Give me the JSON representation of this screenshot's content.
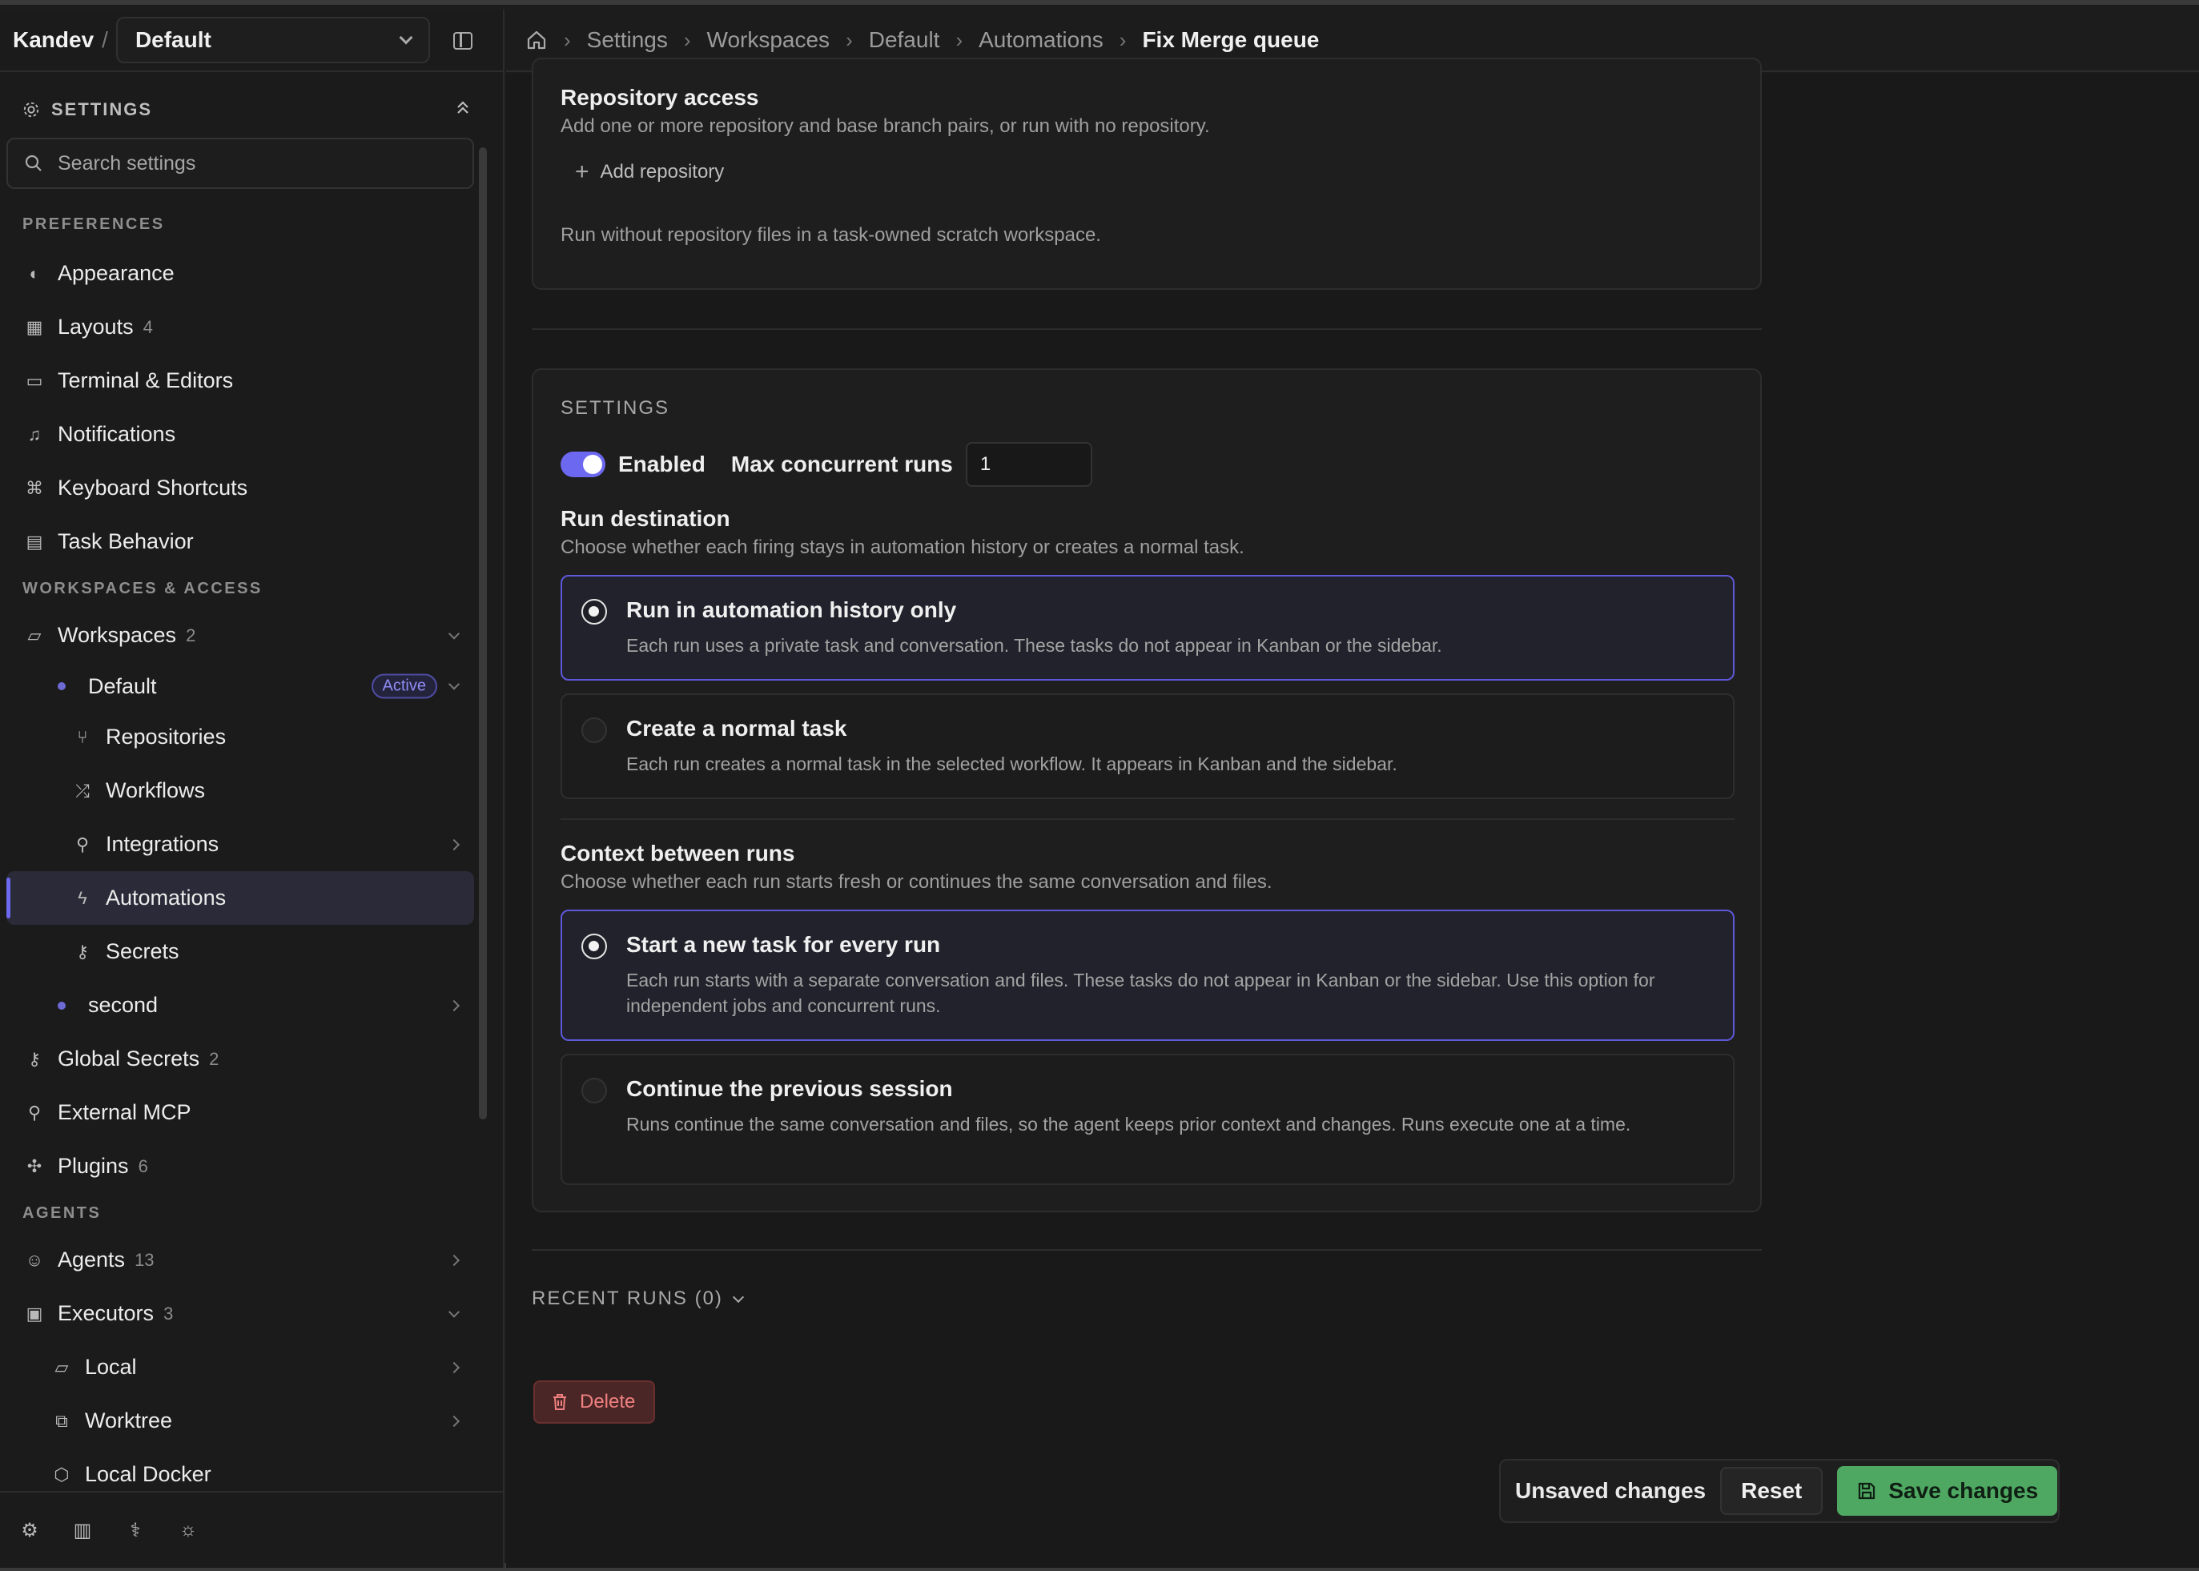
{
  "app": {
    "brand": "Kandev",
    "separator": "/",
    "workspace_select": "Default"
  },
  "sidebar": {
    "settings_label": "SETTINGS",
    "search_placeholder": "Search settings",
    "sections": {
      "preferences": "PREFERENCES",
      "workspaces_access": "WORKSPACES & ACCESS",
      "agents": "AGENTS"
    },
    "items": {
      "appearance": "Appearance",
      "layouts": "Layouts",
      "layouts_count": "4",
      "terminal": "Terminal & Editors",
      "notifications": "Notifications",
      "shortcuts": "Keyboard Shortcuts",
      "task_behavior": "Task Behavior",
      "workspaces": "Workspaces",
      "workspaces_count": "2",
      "default": "Default",
      "active_badge": "Active",
      "repositories": "Repositories",
      "workflows": "Workflows",
      "integrations": "Integrations",
      "automations": "Automations",
      "secrets": "Secrets",
      "second": "second",
      "global_secrets": "Global Secrets",
      "global_secrets_count": "2",
      "external_mcp": "External MCP",
      "plugins": "Plugins",
      "plugins_count": "6",
      "agents": "Agents",
      "agents_count": "13",
      "executors": "Executors",
      "executors_count": "3",
      "local": "Local",
      "worktree": "Worktree",
      "local_docker": "Local Docker"
    }
  },
  "breadcrumb": [
    "Settings",
    "Workspaces",
    "Default",
    "Automations",
    "Fix Merge queue"
  ],
  "repo_access": {
    "title": "Repository access",
    "desc": "Add one or more repository and base branch pairs, or run with no repository.",
    "add_label": "Add repository",
    "no_repo_note": "Run without repository files in a task-owned scratch workspace."
  },
  "settings": {
    "heading": "SETTINGS",
    "enabled_label": "Enabled",
    "max_runs_label": "Max concurrent runs",
    "max_runs_value": "1",
    "run_destination": {
      "title": "Run destination",
      "desc": "Choose whether each firing stays in automation history or creates a normal task.",
      "options": [
        {
          "title": "Run in automation history only",
          "desc": "Each run uses a private task and conversation. These tasks do not appear in Kanban or the sidebar."
        },
        {
          "title": "Create a normal task",
          "desc": "Each run creates a normal task in the selected workflow. It appears in Kanban and the sidebar."
        }
      ]
    },
    "context": {
      "title": "Context between runs",
      "desc": "Choose whether each run starts fresh or continues the same conversation and files.",
      "options": [
        {
          "title": "Start a new task for every run",
          "desc": "Each run starts with a separate conversation and files. These tasks do not appear in Kanban or the sidebar. Use this option for independent jobs and concurrent runs."
        },
        {
          "title": "Continue the previous session",
          "desc": "Runs continue the same conversation and files, so the agent keeps prior context and changes. Runs execute one at a time."
        }
      ]
    }
  },
  "recent_runs": "RECENT RUNS (0)",
  "delete_label": "Delete",
  "savebar": {
    "unsaved": "Unsaved changes",
    "reset": "Reset",
    "save": "Save changes"
  },
  "colors": {
    "accent": "#6d68f0",
    "save": "#4fa862",
    "danger": "#f08080"
  }
}
